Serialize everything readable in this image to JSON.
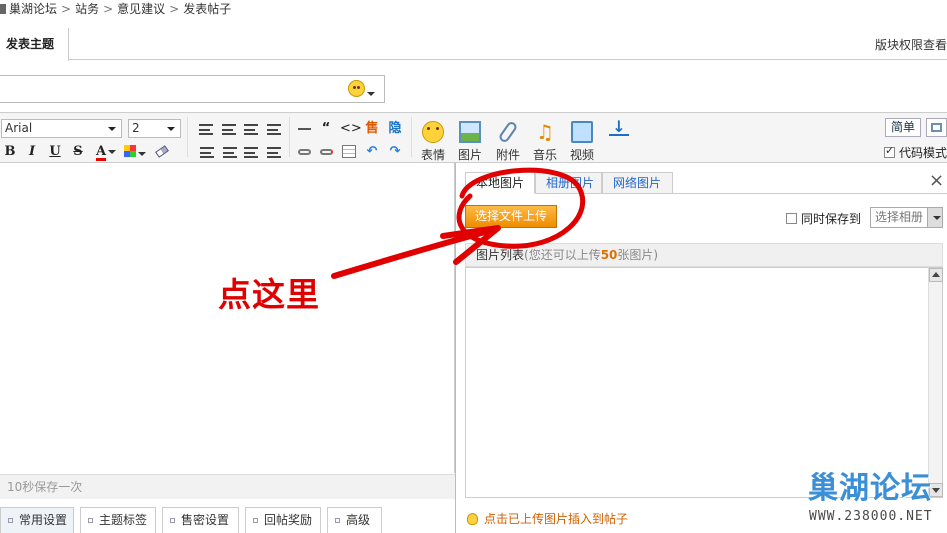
{
  "breadcrumb": [
    "巢湖论坛",
    "站务",
    "意见建议",
    "发表帖子"
  ],
  "header": {
    "tab_label": "发表主题",
    "perm_link": "版块权限查看"
  },
  "toolbar": {
    "font_select": "Arial",
    "size_select": "2",
    "emoji_label": "表情",
    "image_label": "图片",
    "attach_label": "附件",
    "music_label": "音乐",
    "video_label": "视频",
    "simple_label": "简单",
    "code_mode_label": "代码模式"
  },
  "editor": {
    "autosave": "10秒保存一次"
  },
  "bottom_tabs": [
    "常用设置",
    "主题标签",
    "售密设置",
    "回帖奖励",
    "高级"
  ],
  "dialog": {
    "tabs": [
      "本地图片",
      "相册图片",
      "网络图片"
    ],
    "upload_button": "选择文件上传",
    "save_album_label": "同时保存到",
    "album_select": "选择相册",
    "list_title": "图片列表",
    "list_hint_prefix": "(您还可以上传",
    "list_hint_count": "50",
    "list_hint_suffix": "张图片)",
    "insert_tip": "点击已上传图片插入到帖子"
  },
  "annotation": {
    "text": "点这里",
    "color": "#e00000"
  },
  "watermark": {
    "logo": "巢湖论坛",
    "url": "WWW.238000.NET"
  },
  "colors": {
    "accent_orange": "#ee8c00",
    "link_blue": "#2266cc",
    "annotation_red": "#e00000"
  }
}
